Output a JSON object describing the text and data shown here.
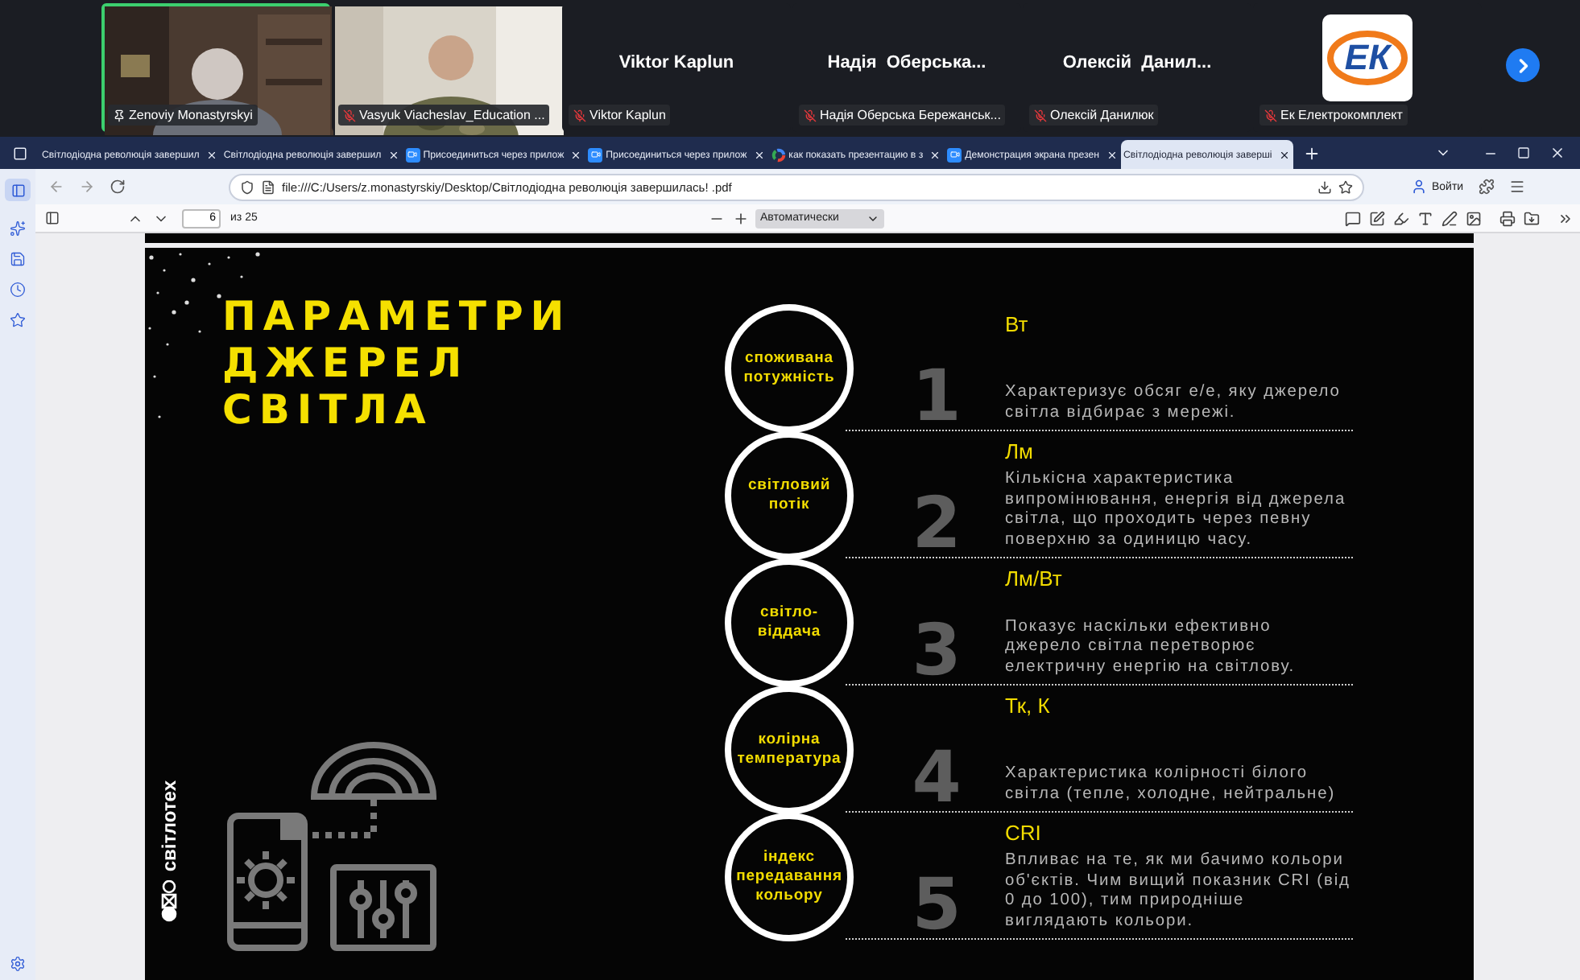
{
  "meeting": {
    "participants": [
      {
        "kind": "video",
        "label": "Zenoviy Monastyrskyi",
        "pinned": true,
        "muted": false,
        "speaking": true
      },
      {
        "kind": "video",
        "label": "Vasyuk Viacheslav_Education ...",
        "pinned": false,
        "muted": true,
        "speaking": false
      },
      {
        "kind": "name",
        "name": "Viktor Kaplun",
        "label": "Viktor Kaplun",
        "pinned": false,
        "muted": true,
        "speaking": false
      },
      {
        "kind": "name",
        "name": "Надія  Оберська...",
        "label": "Надія Оберська Бережанськ...",
        "pinned": false,
        "muted": true,
        "speaking": false
      },
      {
        "kind": "name",
        "name": "Олексій  Данил...",
        "label": "Олексій Данилюк",
        "pinned": false,
        "muted": true,
        "speaking": false
      },
      {
        "kind": "logo",
        "logo_text": "ЕК",
        "label": "Ек Електрокомплект",
        "pinned": false,
        "muted": true,
        "speaking": false
      }
    ]
  },
  "browser": {
    "tabs": [
      {
        "label": "Світлодіодна революція завершил",
        "kind": "document",
        "selected": false
      },
      {
        "label": "Світлодіодна революція завершил",
        "kind": "document",
        "selected": false
      },
      {
        "label": "Присоединиться через прилож",
        "kind": "meeting",
        "selected": false
      },
      {
        "label": "Присоединиться через прилож",
        "kind": "meeting",
        "selected": false
      },
      {
        "label": "как показать презентацию в з",
        "kind": "search",
        "selected": false
      },
      {
        "label": "Демонстрация экрана презен",
        "kind": "meeting",
        "selected": false
      },
      {
        "label": "Світлодіодна революція заверші",
        "kind": "document",
        "selected": true
      }
    ],
    "address": "file:///C:/Users/z.monastyrskiy/Desktop/Світлодіодна революція завершилась! .pdf",
    "sign_in": "Войти"
  },
  "pdf_toolbar": {
    "page": "6",
    "page_count": "из 25",
    "zoom": "Автоматически"
  },
  "slide": {
    "title_lines": [
      "ПАРАМЕТРИ",
      "ДЖЕРЕЛ",
      "СВІТЛА"
    ],
    "logo_text": "світлотех",
    "parameters": [
      {
        "label": "споживана\nпотужність",
        "number": "1",
        "unit": "Вт",
        "description": "Характеризує обсяг е/е, яку джерело світла відбирає з мережі."
      },
      {
        "label": "світловий\nпотік",
        "number": "2",
        "unit": "Лм",
        "description": "Кількісна характеристика випромінювання, енергія від джерела світла, що проходить через певну поверхню за одиницю часу."
      },
      {
        "label": "світло-\nвіддача",
        "number": "3",
        "unit": "Лм/Вт",
        "description": "Показує наскільки ефективно джерело світла перетворює електричну енергію на світлову."
      },
      {
        "label": "колірна\nтемпература",
        "number": "4",
        "unit": "Тк, К",
        "description": "Характеристика колірності білого світла (тепле, холодне, нейтральне)"
      },
      {
        "label": "індекс\nпередавання\nкольору",
        "number": "5",
        "unit": "CRI",
        "description": "Впливає на те, як ми бачимо кольори об'єктів. Чим вищий показник CRI (від 0 до 100), тим природніше виглядають кольори."
      }
    ]
  }
}
